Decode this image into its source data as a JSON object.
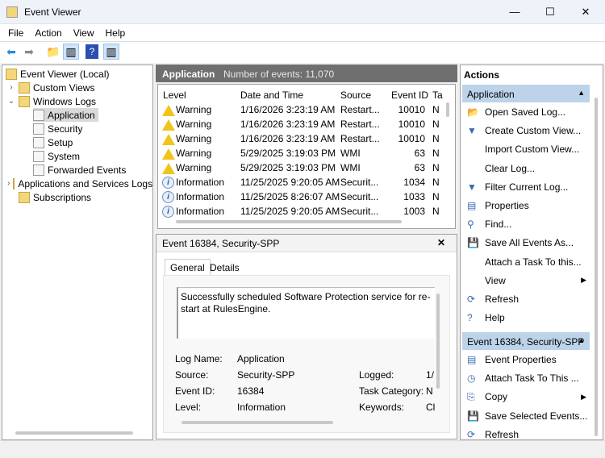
{
  "window": {
    "title": "Event Viewer",
    "min": "—",
    "max": "☐",
    "close": "✕"
  },
  "menu": [
    "File",
    "Action",
    "View",
    "Help"
  ],
  "tree": {
    "root": "Event Viewer (Local)",
    "items": [
      {
        "label": "Custom Views",
        "level": 1,
        "chev": "›"
      },
      {
        "label": "Windows Logs",
        "level": 1,
        "chev": "⌄"
      },
      {
        "label": "Application",
        "level": 2,
        "selected": true
      },
      {
        "label": "Security",
        "level": 2
      },
      {
        "label": "Setup",
        "level": 2
      },
      {
        "label": "System",
        "level": 2
      },
      {
        "label": "Forwarded Events",
        "level": 2
      },
      {
        "label": "Applications and Services Logs",
        "level": 1,
        "chev": "›"
      },
      {
        "label": "Subscriptions",
        "level": 1
      }
    ]
  },
  "center": {
    "title": "Application",
    "count": "Number of events: 11,070",
    "columns": [
      "Level",
      "Date and Time",
      "Source",
      "Event ID",
      "Ta"
    ],
    "rows": [
      [
        "Warning",
        "1/16/2026 3:23:19 AM",
        "Restart...",
        "10010",
        "N"
      ],
      [
        "Warning",
        "1/16/2026 3:23:19 AM",
        "Restart...",
        "10010",
        "N"
      ],
      [
        "Warning",
        "1/16/2026 3:23:19 AM",
        "Restart...",
        "10010",
        "N"
      ],
      [
        "Warning",
        "5/29/2025 3:19:03 PM",
        "WMI",
        "63",
        "N"
      ],
      [
        "Warning",
        "5/29/2025 3:19:03 PM",
        "WMI",
        "63",
        "N"
      ],
      [
        "Information",
        "11/25/2025 9:20:05 AM",
        "Securit...",
        "1034",
        "N"
      ],
      [
        "Information",
        "11/25/2025 8:26:07 AM",
        "Securit...",
        "1033",
        "N"
      ],
      [
        "Information",
        "11/25/2025 9:20:05 AM",
        "Securit...",
        "1003",
        "N"
      ]
    ]
  },
  "detail": {
    "title": "Event 16384, Security-SPP",
    "close": "✕",
    "tabs": [
      "General",
      "Details"
    ],
    "message": "Successfully scheduled Software Protection service for re-start at RulesEngine.",
    "fields": {
      "log_name_label": "Log Name:",
      "log_name": "Application",
      "source_label": "Source:",
      "source": "Security-SPP",
      "event_id_label": "Event ID:",
      "event_id": "16384",
      "level_label": "Level:",
      "level": "Information",
      "logged_label": "Logged:",
      "logged": "1/",
      "task_label": "Task Category:",
      "task": "N",
      "keywords_label": "Keywords:",
      "keywords": "Cl"
    }
  },
  "actions": {
    "title": "Actions",
    "section1": {
      "title": "Application",
      "items": [
        {
          "label": "Open Saved Log...",
          "icon": "📂"
        },
        {
          "label": "Create Custom View...",
          "icon": "▼"
        },
        {
          "label": "Import Custom View...",
          "icon": ""
        },
        {
          "label": "Clear Log...",
          "icon": ""
        },
        {
          "label": "Filter Current Log...",
          "icon": "▼"
        },
        {
          "label": "Properties",
          "icon": "▤"
        },
        {
          "label": "Find...",
          "icon": "⚲"
        },
        {
          "label": "Save All Events As...",
          "icon": "💾"
        },
        {
          "label": "Attach a Task To this...",
          "icon": ""
        },
        {
          "label": "View",
          "icon": "",
          "submenu": true
        },
        {
          "label": "Refresh",
          "icon": "⟳"
        },
        {
          "label": "Help",
          "icon": "?"
        }
      ]
    },
    "section2": {
      "title": "Event 16384, Security-SPP",
      "items": [
        {
          "label": "Event Properties",
          "icon": "▤"
        },
        {
          "label": "Attach Task To This ...",
          "icon": "◷"
        },
        {
          "label": "Copy",
          "icon": "⎘",
          "submenu": true
        },
        {
          "label": "Save Selected Events...",
          "icon": "💾"
        },
        {
          "label": "Refresh",
          "icon": "⟳"
        }
      ]
    }
  }
}
